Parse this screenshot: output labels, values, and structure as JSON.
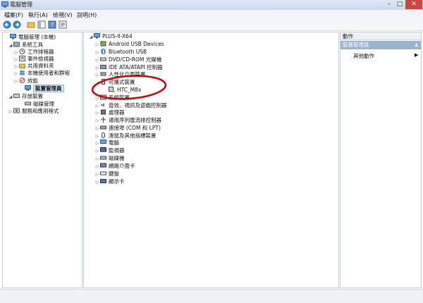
{
  "window": {
    "title": "電腦管理"
  },
  "menu": [
    "檔案(F)",
    "執行(A)",
    "檢視(V)",
    "說明(H)"
  ],
  "left_tree": [
    {
      "label": "電腦管理 (本機)",
      "level": 0,
      "arrow": "",
      "icon": "computer-management-icon"
    },
    {
      "label": "系統工具",
      "level": 1,
      "arrow": "◢",
      "icon": "tools-icon"
    },
    {
      "label": "工作排程器",
      "level": 2,
      "arrow": "▷",
      "icon": "clock-icon"
    },
    {
      "label": "事件檢視器",
      "level": 2,
      "arrow": "▷",
      "icon": "event-viewer-icon"
    },
    {
      "label": "共用資料夾",
      "level": 2,
      "arrow": "▷",
      "icon": "folder-icon"
    },
    {
      "label": "本機使用者和群組",
      "level": 2,
      "arrow": "▷",
      "icon": "users-icon"
    },
    {
      "label": "效能",
      "level": 2,
      "arrow": "▷",
      "icon": "performance-icon"
    },
    {
      "label": "裝置管理員",
      "level": 2,
      "arrow": "",
      "icon": "device-manager-icon",
      "selected": true
    },
    {
      "label": "存放裝置",
      "level": 1,
      "arrow": "◢",
      "icon": "storage-icon"
    },
    {
      "label": "磁碟管理",
      "level": 2,
      "arrow": "",
      "icon": "disk-icon"
    },
    {
      "label": "服務和應用程式",
      "level": 1,
      "arrow": "▷",
      "icon": "services-icon"
    }
  ],
  "center_tree": [
    {
      "label": "PLUS-II-X64",
      "level": 0,
      "arrow": "◢",
      "icon": "computer-icon"
    },
    {
      "label": "Android USB Devices",
      "level": 1,
      "arrow": "▷",
      "icon": "android-icon"
    },
    {
      "label": "Bluetooth USB",
      "level": 1,
      "arrow": "▷",
      "icon": "bluetooth-icon"
    },
    {
      "label": "DVD/CD-ROM 光碟機",
      "level": 1,
      "arrow": "▷",
      "icon": "dvd-icon"
    },
    {
      "label": "IDE ATA/ATAPI 控制器",
      "level": 1,
      "arrow": "▷",
      "icon": "ide-icon"
    },
    {
      "label": "人性化介面裝置",
      "level": 1,
      "arrow": "▷",
      "icon": "hid-icon"
    },
    {
      "label": "可攜式裝置",
      "level": 1,
      "arrow": "◢",
      "icon": "portable-icon"
    },
    {
      "label": "HTC_M8x",
      "level": 2,
      "arrow": "",
      "icon": "warning-device-icon"
    },
    {
      "label": "系統裝置",
      "level": 1,
      "arrow": "▷",
      "icon": "system-icon"
    },
    {
      "label": "音效、視訊及遊戲控制器",
      "level": 1,
      "arrow": "▷",
      "icon": "sound-icon"
    },
    {
      "label": "處理器",
      "level": 1,
      "arrow": "▷",
      "icon": "cpu-icon"
    },
    {
      "label": "通用序列匯流排控制器",
      "level": 1,
      "arrow": "▷",
      "icon": "usb-icon"
    },
    {
      "label": "連接埠 (COM 和 LPT)",
      "level": 1,
      "arrow": "▷",
      "icon": "port-icon"
    },
    {
      "label": "滑鼠及其他指標裝置",
      "level": 1,
      "arrow": "▷",
      "icon": "mouse-icon"
    },
    {
      "label": "電腦",
      "level": 1,
      "arrow": "▷",
      "icon": "pc-icon"
    },
    {
      "label": "監視器",
      "level": 1,
      "arrow": "▷",
      "icon": "monitor-icon"
    },
    {
      "label": "磁碟機",
      "level": 1,
      "arrow": "▷",
      "icon": "disk-drive-icon"
    },
    {
      "label": "網路介面卡",
      "level": 1,
      "arrow": "▷",
      "icon": "network-icon"
    },
    {
      "label": "鍵盤",
      "level": 1,
      "arrow": "▷",
      "icon": "keyboard-icon"
    },
    {
      "label": "顯示卡",
      "level": 1,
      "arrow": "▷",
      "icon": "display-adapter-icon"
    }
  ],
  "actions": {
    "header": "動作",
    "section": "裝置管理員",
    "item": "其他動作"
  },
  "colors": {
    "selection": "#d7e6f7",
    "annotation": "#d40000",
    "actions_bar": "#9ab3cf"
  }
}
